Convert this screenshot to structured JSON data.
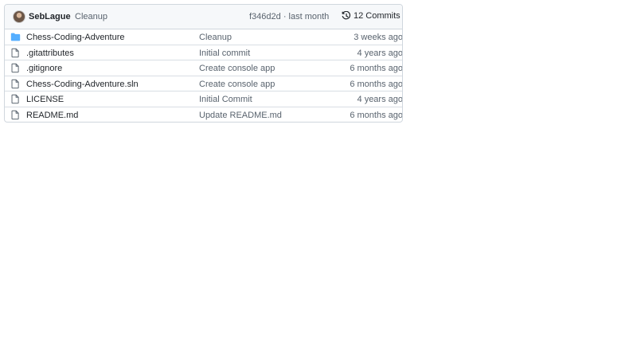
{
  "latest_commit": {
    "author": "SebLague",
    "message": "Cleanup",
    "meta": "f346d2d · last month",
    "commits_label": "12 Commits"
  },
  "files": [
    {
      "name": "Chess-Coding-Adventure",
      "type": "folder",
      "message": "Cleanup",
      "age": "3 weeks ago"
    },
    {
      "name": ".gitattributes",
      "type": "file",
      "message": "Initial commit",
      "age": "4 years ago"
    },
    {
      "name": ".gitignore",
      "type": "file",
      "message": "Create console app",
      "age": "6 months ago"
    },
    {
      "name": "Chess-Coding-Adventure.sln",
      "type": "file",
      "message": "Create console app",
      "age": "6 months ago"
    },
    {
      "name": "LICENSE",
      "type": "file",
      "message": "Initial Commit",
      "age": "4 years ago"
    },
    {
      "name": "README.md",
      "type": "file",
      "message": "Update README.md",
      "age": "6 months ago"
    }
  ],
  "icons": {
    "folder": "folder-icon",
    "file": "file-icon",
    "history": "history-icon"
  },
  "colors": {
    "folder": "#54aeff",
    "header_bg": "#f6f8fa",
    "border": "#d0d7de",
    "muted_text": "#59636e"
  }
}
